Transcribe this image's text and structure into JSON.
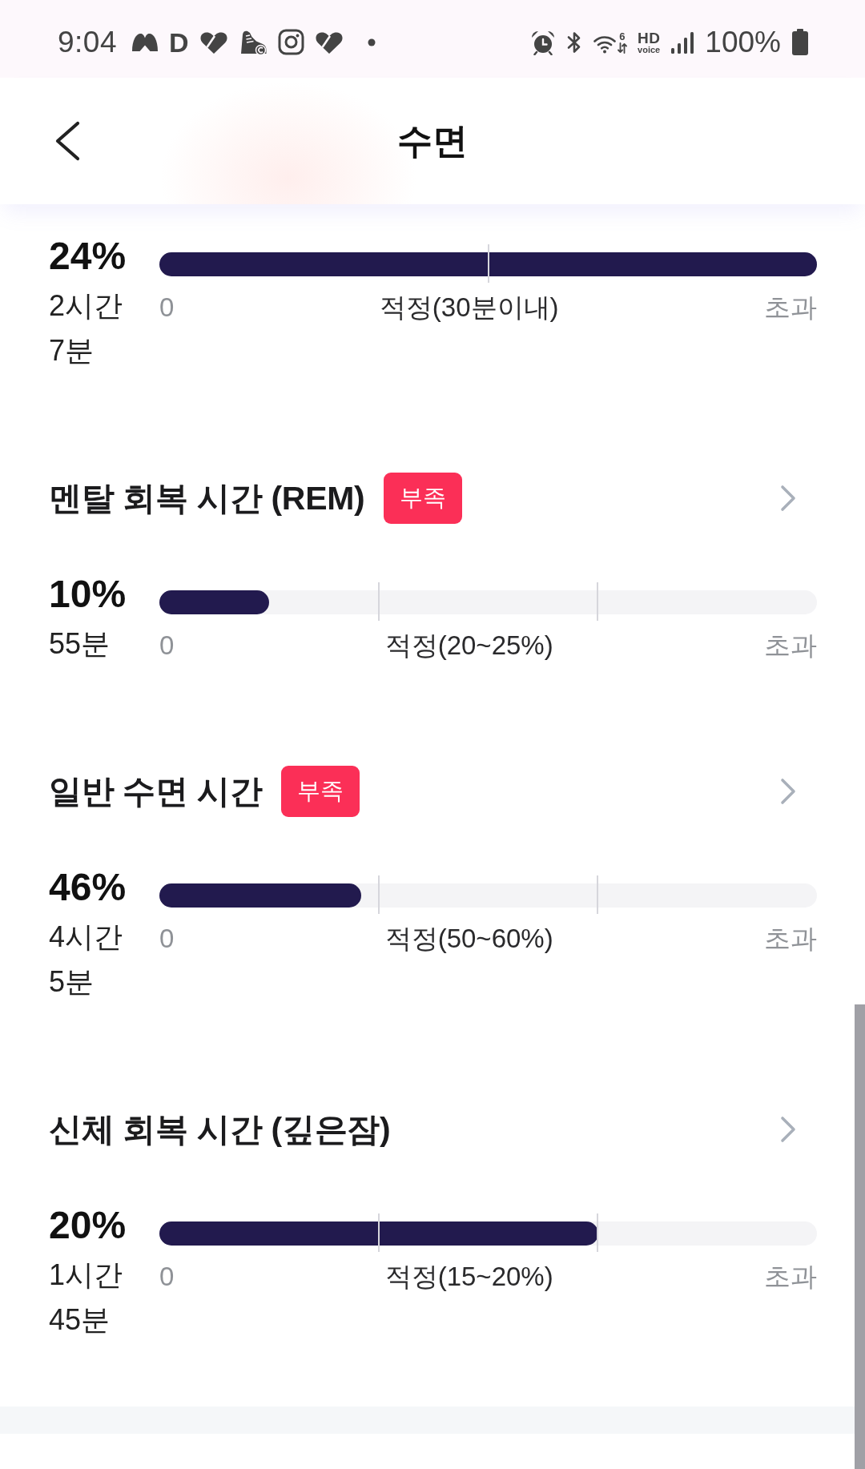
{
  "status_bar": {
    "time": "9:04",
    "notification_icons": [
      {
        "kind": "mask"
      },
      {
        "kind": "letter",
        "text": "D"
      },
      {
        "kind": "heart"
      },
      {
        "kind": "sneaker"
      },
      {
        "kind": "camera"
      },
      {
        "kind": "heart"
      },
      {
        "kind": "dot"
      }
    ],
    "wifi_standard": "6",
    "hd_voice": {
      "top": "HD",
      "bottom": "voice"
    },
    "battery": "100%"
  },
  "header": {
    "title": "수면"
  },
  "sections": [
    {
      "kind": "limit",
      "percent": "24%",
      "duration": "2시간 7분",
      "level": 1,
      "scale": {
        "start": "0",
        "target": "적정(30분이내)",
        "end": "초과"
      }
    },
    {
      "kind": "range",
      "title": "멘탈 회복 시간 (REM)",
      "badge": "부족",
      "percent": "10%",
      "duration": "55분",
      "level": 0.167,
      "scale": {
        "start": "0",
        "target": "적정(20~25%)",
        "end": "초과"
      }
    },
    {
      "kind": "range",
      "title": "일반 수면 시간",
      "badge": "부족",
      "percent": "46%",
      "duration": "4시간 5분",
      "level": 0.307,
      "scale": {
        "start": "0",
        "target": "적정(50~60%)",
        "end": "초과"
      }
    },
    {
      "kind": "range",
      "title": "신체 회복 시간 (깊은잠)",
      "percent": "20%",
      "duration": "1시간 45분",
      "level": 0.667,
      "scale": {
        "start": "0",
        "target": "적정(15~20%)",
        "end": "초과"
      }
    }
  ]
}
